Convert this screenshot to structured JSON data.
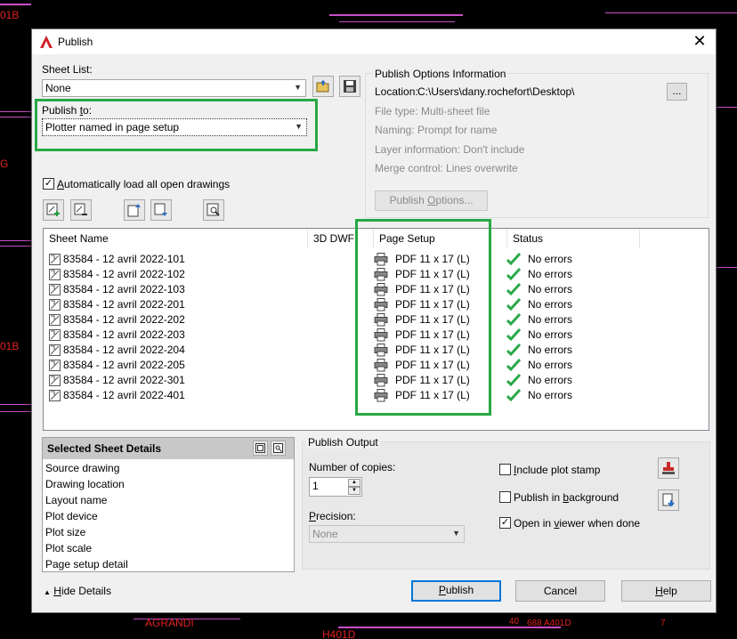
{
  "background": {
    "labels": [
      "01B",
      "G",
      "01B",
      "AGRANDI",
      "H401D",
      "40",
      "688",
      "A401D",
      "7"
    ]
  },
  "dialog": {
    "title": "Publish",
    "close_label": "✕"
  },
  "sheet_list": {
    "label": "Sheet List:",
    "value": "None"
  },
  "publish_to": {
    "label_prefix": "Publish ",
    "label_ul": "t",
    "label_suffix": "o:",
    "value": "Plotter named in page setup"
  },
  "auto_load": {
    "label_prefix": "",
    "label_ul": "A",
    "label_suffix": "utomatically load all open drawings",
    "checked": true
  },
  "options_info": {
    "heading": "Publish Options Information",
    "location_label": "Location:",
    "location_value": "C:\\Users\\dany.rochefort\\Desktop\\",
    "browse_label": "...",
    "file_type": "File type: Multi-sheet file",
    "naming": "Naming: Prompt for name",
    "layer_info": "Layer information: Don't include",
    "merge_control": "Merge control: Lines overwrite",
    "publish_options_prefix": "Publish ",
    "publish_options_ul": "O",
    "publish_options_suffix": "ptions..."
  },
  "columns": {
    "sheet_name": "Sheet Name",
    "dwf3d": "3D DWF",
    "page_setup": "Page Setup",
    "status": "Status"
  },
  "sheets": [
    {
      "name": "83584 - 12 avril 2022-101",
      "page_setup": "PDF 11 x 17 (L)",
      "status": "No errors"
    },
    {
      "name": "83584 - 12 avril 2022-102",
      "page_setup": "PDF 11 x 17 (L)",
      "status": "No errors"
    },
    {
      "name": "83584 - 12 avril 2022-103",
      "page_setup": "PDF 11 x 17 (L)",
      "status": "No errors"
    },
    {
      "name": "83584 - 12 avril 2022-201",
      "page_setup": "PDF 11 x 17 (L)",
      "status": "No errors"
    },
    {
      "name": "83584 - 12 avril 2022-202",
      "page_setup": "PDF 11 x 17 (L)",
      "status": "No errors"
    },
    {
      "name": "83584 - 12 avril 2022-203",
      "page_setup": "PDF 11 x 17 (L)",
      "status": "No errors"
    },
    {
      "name": "83584 - 12 avril 2022-204",
      "page_setup": "PDF 11 x 17 (L)",
      "status": "No errors"
    },
    {
      "name": "83584 - 12 avril 2022-205",
      "page_setup": "PDF 11 x 17 (L)",
      "status": "No errors"
    },
    {
      "name": "83584 - 12 avril 2022-301",
      "page_setup": "PDF 11 x 17 (L)",
      "status": "No errors"
    },
    {
      "name": "83584 - 12 avril 2022-401",
      "page_setup": "PDF 11 x 17 (L)",
      "status": "No errors"
    }
  ],
  "selected_details": {
    "heading": "Selected Sheet Details",
    "items": [
      "Source drawing",
      "Drawing location",
      "Layout name",
      "Plot device",
      "Plot size",
      "Plot scale",
      "Page setup detail"
    ]
  },
  "publish_output": {
    "heading": "Publish Output",
    "copies_label": "Number of copies:",
    "copies_value": "1",
    "precision_label_prefix": "",
    "precision_label_ul": "P",
    "precision_label_suffix": "recision:",
    "precision_value": "None",
    "plot_stamp_prefix": "",
    "plot_stamp_ul": "I",
    "plot_stamp_suffix": "nclude plot stamp",
    "plot_stamp_checked": false,
    "background_prefix": "Publish in ",
    "background_ul": "b",
    "background_suffix": "ackground",
    "background_checked": false,
    "viewer_prefix": "Open in ",
    "viewer_ul": "v",
    "viewer_suffix": "iewer when done",
    "viewer_checked": true
  },
  "footer": {
    "hide_details_prefix": "",
    "hide_details_ul": "H",
    "hide_details_suffix": "ide Details",
    "publish_prefix": "",
    "publish_ul": "P",
    "publish_suffix": "ublish",
    "cancel": "Cancel",
    "help_prefix": "",
    "help_ul": "H",
    "help_suffix": "elp"
  },
  "colors": {
    "highlight": "#27a844",
    "accent": "#0078d7",
    "check_green": "#2aa84a"
  }
}
